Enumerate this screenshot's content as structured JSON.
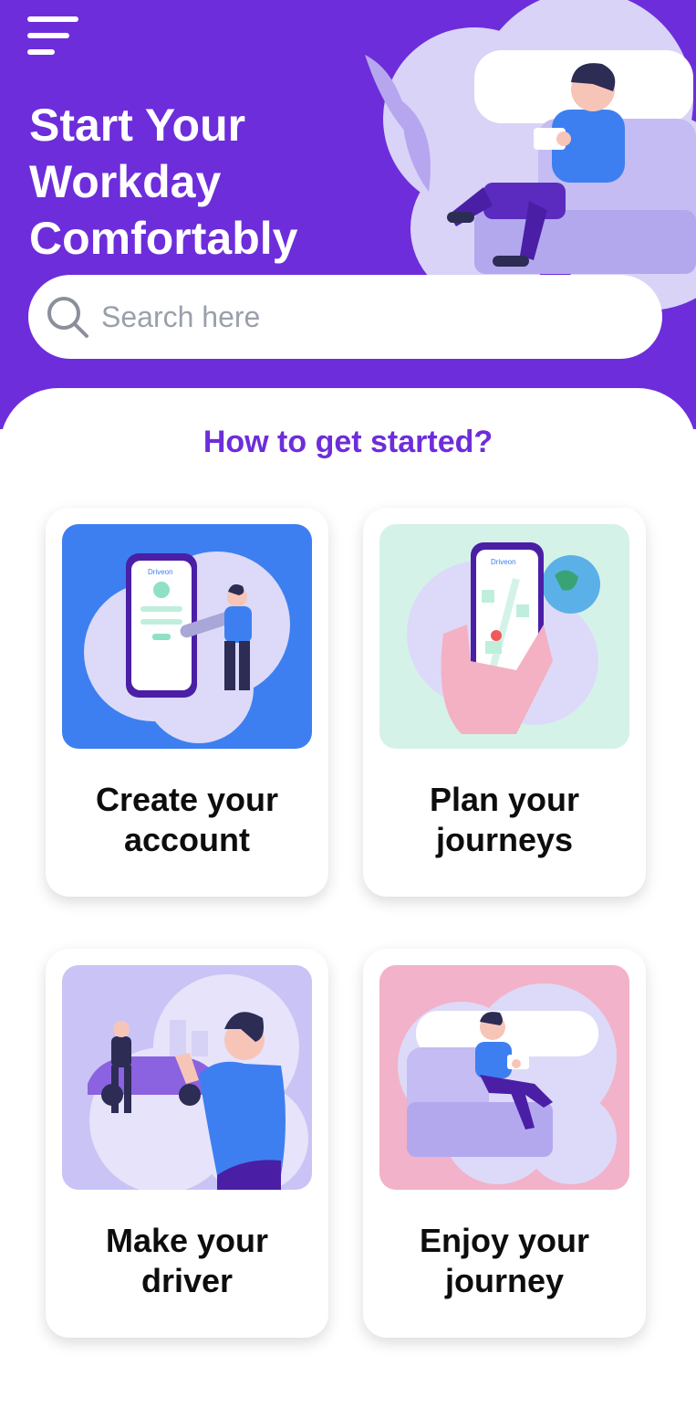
{
  "hero": {
    "title_lines": [
      "Start Your",
      "Workday",
      "Comfortably"
    ]
  },
  "search": {
    "placeholder": "Search here"
  },
  "section": {
    "title": "How to get started?"
  },
  "cards": [
    {
      "line1": "Create your",
      "line2": "account",
      "art_bg": "#3d7ff0",
      "phone_brand": "Driveon"
    },
    {
      "line1": "Plan your",
      "line2": "journeys",
      "art_bg": "#d5f2e8",
      "phone_brand": "Driveon"
    },
    {
      "line1": "Make your",
      "line2": "driver",
      "art_bg": "#c9c4f5"
    },
    {
      "line1": "Enjoy your",
      "line2": "journey",
      "art_bg": "#f2b2c9"
    }
  ],
  "colors": {
    "brand": "#6d2ddb",
    "white": "#ffffff"
  }
}
